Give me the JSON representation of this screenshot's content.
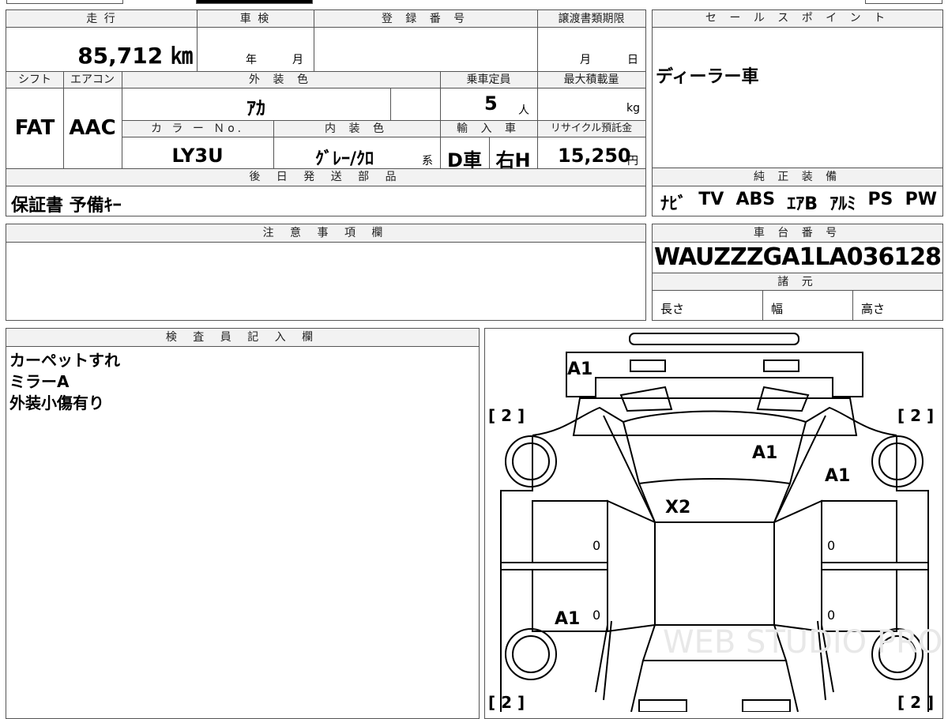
{
  "top": {
    "mileage_label": "走 行",
    "shaken_label": "車 検",
    "reg_label": "登 録 番 号",
    "transfer_label": "譲渡書類期限",
    "mileage_value": "85,712 ㎞",
    "year_unit": "年",
    "month_unit": "月",
    "transfer_month": "月",
    "transfer_day": "日",
    "shift_label": "シフト",
    "aircon_label": "エアコン",
    "exterior_label": "外 装 色",
    "capacity_label": "乗車定員",
    "maxload_label": "最大積載量",
    "shift_value": "FAT",
    "aircon_value": "AAC",
    "exterior_value": "ｱｶ",
    "capacity_value": "5",
    "capacity_unit": "人",
    "maxload_unit": "kg",
    "colorno_label": "カ ラ ー Ｎo.",
    "interior_label": "内 装 色",
    "import_label": "輸 入 車",
    "recycle_label": "リサイクル預託金",
    "colorno_value": "LY3U",
    "interior_value": "ｸﾞﾚｰ/ｸﾛ",
    "interior_unit": "系",
    "import_d": "D車",
    "import_h": "右H",
    "recycle_value": "15,250",
    "recycle_unit": "円",
    "later_label": "後 日 発 送 部 品",
    "later_value": "保証書  予備ｷｰ"
  },
  "sales": {
    "label": "セ ー ル ス ポ イ ン ト",
    "value": "ディーラー車"
  },
  "equipment": {
    "label": "純 正 装 備",
    "items": [
      "ﾅﾋﾞ",
      "TV",
      "ABS",
      "ｴｱB",
      "ｱﾙﾐ",
      "PS",
      "PW"
    ]
  },
  "notes": {
    "label": "注 意 事 項 欄",
    "value": ""
  },
  "chassis": {
    "label": "車 台 番 号",
    "value": "WAUZZZGA1LA036128",
    "spec_label": "諸 元",
    "length_label": "長さ",
    "width_label": "幅",
    "height_label": "高さ"
  },
  "inspector": {
    "label": "検 査 員 記 入 欄",
    "lines": [
      "カーペットすれ",
      "ミラーA",
      "外装小傷有り"
    ]
  },
  "diagram": {
    "marks": [
      "A1",
      "A1",
      "A1",
      "X2",
      "A1"
    ],
    "tires": [
      "[ 2 ]",
      "[ 2 ]",
      "[ 2 ]",
      "[ 2 ]"
    ],
    "zeros": [
      "0",
      "0",
      "0",
      "0"
    ],
    "watermark": "WEB STUDIO PRO"
  }
}
